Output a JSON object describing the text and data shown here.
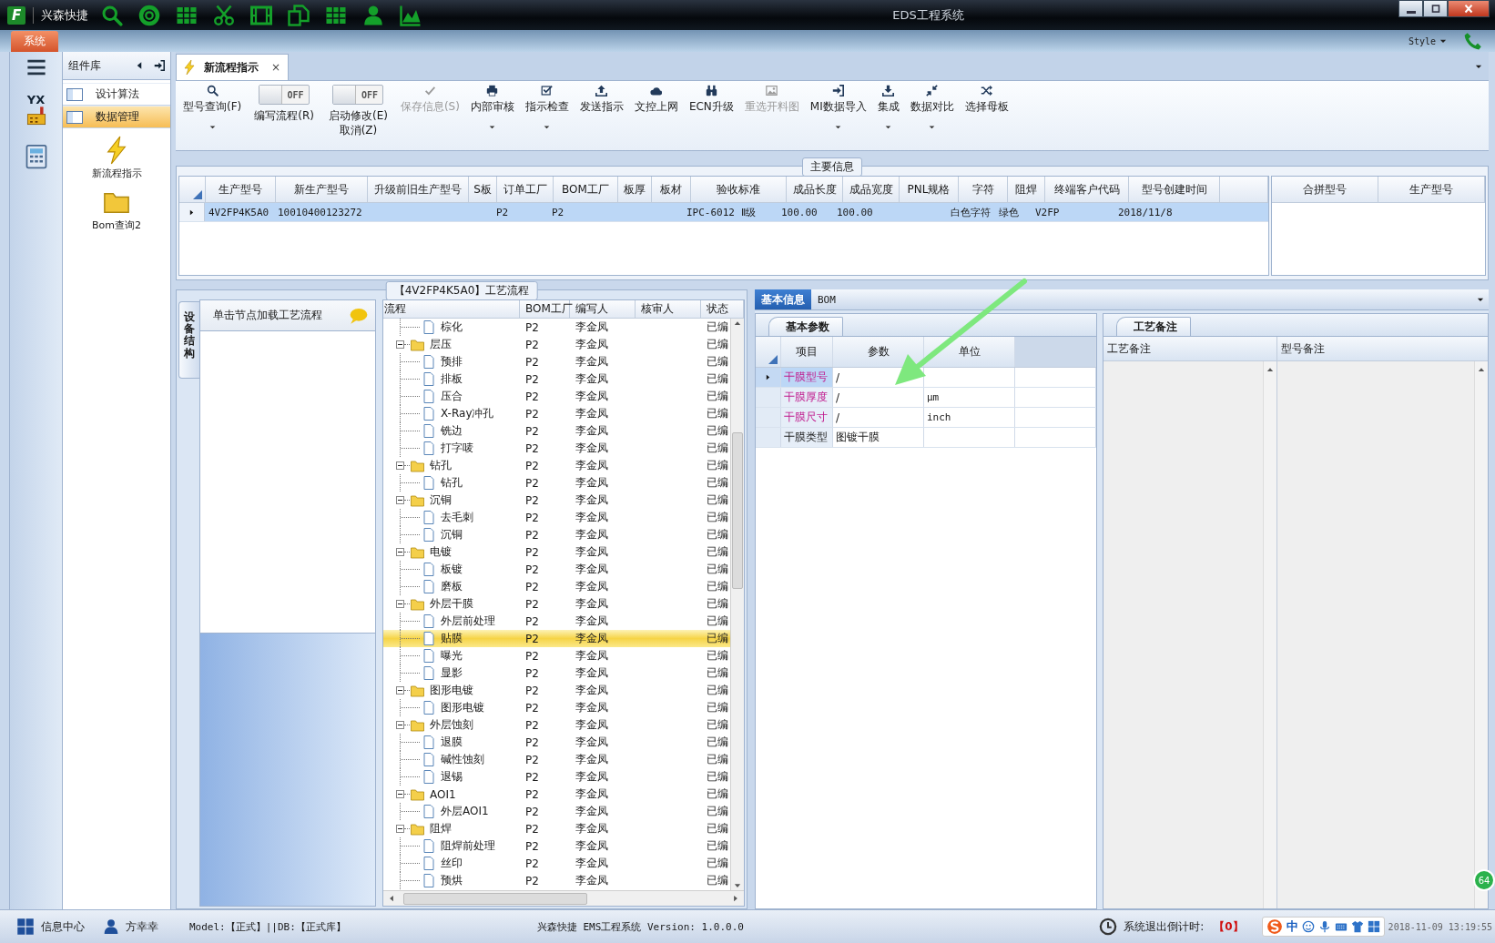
{
  "window": {
    "logo": "F",
    "app_name": "兴森快捷",
    "title": "EDS工程系统"
  },
  "ribbon": {
    "tab": "系统",
    "style_label": "Style"
  },
  "sidebar": {
    "logo_text": "YX"
  },
  "component_panel": {
    "title": "组件库",
    "items": [
      {
        "label": "设计算法",
        "selected": false
      },
      {
        "label": "数据管理",
        "selected": true
      }
    ],
    "shortcuts": [
      "新流程指示",
      "Bom查询2"
    ]
  },
  "doc_tabs": [
    {
      "label": "新流程指示",
      "selected": true,
      "close": "×"
    }
  ],
  "toolbar": [
    {
      "kind": "button",
      "lines": [
        "型号查询(F)"
      ],
      "dropdown": true,
      "disabled": false
    },
    {
      "kind": "toggle",
      "switch": "OFF",
      "on": false,
      "lines": [
        "编写流程(R)"
      ]
    },
    {
      "kind": "toggle",
      "switch": "OFF",
      "on": false,
      "lines": [
        "启动修改(E)",
        "取消(Z)"
      ]
    },
    {
      "kind": "button",
      "lines": [
        "保存信息(S)"
      ],
      "dropdown": false,
      "disabled": true
    },
    {
      "kind": "button",
      "lines": [
        "内部审核"
      ],
      "dropdown": true,
      "disabled": false
    },
    {
      "kind": "button",
      "lines": [
        "指示检查"
      ],
      "dropdown": true,
      "disabled": false
    },
    {
      "kind": "button",
      "lines": [
        "发送指示"
      ],
      "dropdown": false,
      "disabled": false
    },
    {
      "kind": "button",
      "lines": [
        "文控上网"
      ],
      "dropdown": false,
      "disabled": false
    },
    {
      "kind": "button",
      "lines": [
        "ECN升级"
      ],
      "dropdown": false,
      "disabled": false
    },
    {
      "kind": "button",
      "lines": [
        "重选开料图"
      ],
      "dropdown": false,
      "disabled": true
    },
    {
      "kind": "button",
      "lines": [
        "MI数据导入"
      ],
      "dropdown": true,
      "disabled": false
    },
    {
      "kind": "button",
      "lines": [
        "集成"
      ],
      "dropdown": true,
      "disabled": false
    },
    {
      "kind": "button",
      "lines": [
        "数据对比"
      ],
      "dropdown": true,
      "disabled": false
    },
    {
      "kind": "button",
      "lines": [
        "选择母板"
      ],
      "dropdown": false,
      "disabled": false
    }
  ],
  "main_info": {
    "title": "主要信息",
    "columns": [
      "生产型号",
      "新生产型号",
      "升级前旧生产型号",
      "S板",
      "订单工厂",
      "BOM工厂",
      "板厚",
      "板材",
      "验收标准",
      "成品长度",
      "成品宽度",
      "PNL规格",
      "字符",
      "阻焊",
      "终端客户代码",
      "型号创建时间"
    ],
    "rows": [
      {
        "selected": true,
        "cells": [
          "4V2FP4K5A0",
          "10010400123272",
          null,
          null,
          "P2",
          "P2",
          null,
          null,
          "IPC-6012 Ⅱ级",
          "100.00",
          "100.00",
          null,
          "白色字符",
          "绿色",
          "V2FP",
          "2018/11/8"
        ]
      }
    ],
    "side_columns": [
      "合拼型号",
      "生产型号"
    ]
  },
  "process": {
    "title": "【4V2FP4K5A0】工艺流程",
    "side_tab": "设备结构",
    "hint": "单击节点加载工艺流程",
    "columns": [
      "流程",
      "BOM工厂",
      "编写人",
      "核审人",
      "状态"
    ],
    "tree": [
      {
        "children": [
          {
            "kind": "file",
            "label": "棕化",
            "bom": "P2",
            "writer": "李金凤",
            "status": "已编",
            "selected": false
          }
        ]
      },
      {
        "kind": "folder",
        "label": "层压",
        "bom": "P2",
        "writer": "李金凤",
        "status": "已编",
        "selected": false,
        "expanded": true,
        "children": [
          {
            "kind": "file",
            "label": "预排",
            "bom": "P2",
            "writer": "李金凤",
            "status": "已编",
            "selected": false
          },
          {
            "kind": "file",
            "label": "排板",
            "bom": "P2",
            "writer": "李金凤",
            "status": "已编",
            "selected": false
          },
          {
            "kind": "file",
            "label": "压合",
            "bom": "P2",
            "writer": "李金凤",
            "status": "已编",
            "selected": false
          },
          {
            "kind": "file",
            "label": "X-Ray冲孔",
            "bom": "P2",
            "writer": "李金凤",
            "status": "已编",
            "selected": false
          },
          {
            "kind": "file",
            "label": "铣边",
            "bom": "P2",
            "writer": "李金凤",
            "status": "已编",
            "selected": false
          },
          {
            "kind": "file",
            "label": "打字唛",
            "bom": "P2",
            "writer": "李金凤",
            "status": "已编",
            "selected": false
          }
        ]
      },
      {
        "kind": "folder",
        "label": "钻孔",
        "bom": "P2",
        "writer": "李金凤",
        "status": "已编",
        "selected": false,
        "expanded": true,
        "children": [
          {
            "kind": "file",
            "label": "钻孔",
            "bom": "P2",
            "writer": "李金凤",
            "status": "已编",
            "selected": false
          }
        ]
      },
      {
        "kind": "folder",
        "label": "沉铜",
        "bom": "P2",
        "writer": "李金凤",
        "status": "已编",
        "selected": false,
        "expanded": true,
        "children": [
          {
            "kind": "file",
            "label": "去毛刺",
            "bom": "P2",
            "writer": "李金凤",
            "status": "已编",
            "selected": false
          },
          {
            "kind": "file",
            "label": "沉铜",
            "bom": "P2",
            "writer": "李金凤",
            "status": "已编",
            "selected": false
          }
        ]
      },
      {
        "kind": "folder",
        "label": "电镀",
        "bom": "P2",
        "writer": "李金凤",
        "status": "已编",
        "selected": false,
        "expanded": true,
        "children": [
          {
            "kind": "file",
            "label": "板镀",
            "bom": "P2",
            "writer": "李金凤",
            "status": "已编",
            "selected": false
          },
          {
            "kind": "file",
            "label": "磨板",
            "bom": "P2",
            "writer": "李金凤",
            "status": "已编",
            "selected": false
          }
        ]
      },
      {
        "kind": "folder",
        "label": "外层干膜",
        "bom": "P2",
        "writer": "李金凤",
        "status": "已编",
        "selected": false,
        "expanded": true,
        "children": [
          {
            "kind": "file",
            "label": "外层前处理",
            "bom": "P2",
            "writer": "李金凤",
            "status": "已编",
            "selected": false
          },
          {
            "kind": "file",
            "label": "贴膜",
            "bom": "P2",
            "writer": "李金凤",
            "status": "已编",
            "selected": true
          },
          {
            "kind": "file",
            "label": "曝光",
            "bom": "P2",
            "writer": "李金凤",
            "status": "已编",
            "selected": false
          },
          {
            "kind": "file",
            "label": "显影",
            "bom": "P2",
            "writer": "李金凤",
            "status": "已编",
            "selected": false
          }
        ]
      },
      {
        "kind": "folder",
        "label": "图形电镀",
        "bom": "P2",
        "writer": "李金凤",
        "status": "已编",
        "selected": false,
        "expanded": true,
        "children": [
          {
            "kind": "file",
            "label": "图形电镀",
            "bom": "P2",
            "writer": "李金凤",
            "status": "已编",
            "selected": false
          }
        ]
      },
      {
        "kind": "folder",
        "label": "外层蚀刻",
        "bom": "P2",
        "writer": "李金凤",
        "status": "已编",
        "selected": false,
        "expanded": true,
        "children": [
          {
            "kind": "file",
            "label": "退膜",
            "bom": "P2",
            "writer": "李金凤",
            "status": "已编",
            "selected": false
          },
          {
            "kind": "file",
            "label": "碱性蚀刻",
            "bom": "P2",
            "writer": "李金凤",
            "status": "已编",
            "selected": false
          },
          {
            "kind": "file",
            "label": "退锡",
            "bom": "P2",
            "writer": "李金凤",
            "status": "已编",
            "selected": false
          }
        ]
      },
      {
        "kind": "folder",
        "label": "AOI1",
        "bom": "P2",
        "writer": "李金凤",
        "status": "已编",
        "selected": false,
        "expanded": true,
        "children": [
          {
            "kind": "file",
            "label": "外层AOI1",
            "bom": "P2",
            "writer": "李金凤",
            "status": "已编",
            "selected": false
          }
        ]
      },
      {
        "kind": "folder",
        "label": "阻焊",
        "bom": "P2",
        "writer": "李金凤",
        "status": "已编",
        "selected": false,
        "expanded": true,
        "children": [
          {
            "kind": "file",
            "label": "阻焊前处理",
            "bom": "P2",
            "writer": "李金凤",
            "status": "已编",
            "selected": false
          },
          {
            "kind": "file",
            "label": "丝印",
            "bom": "P2",
            "writer": "李金凤",
            "status": "已编",
            "selected": false
          },
          {
            "kind": "file",
            "label": "预烘",
            "bom": "P2",
            "writer": "李金凤",
            "status": "已编",
            "selected": false
          }
        ]
      }
    ]
  },
  "detail": {
    "tabs": [
      {
        "label": "基本信息",
        "selected": true
      },
      {
        "label": "BOM",
        "selected": false
      }
    ],
    "params": {
      "tab": "基本参数",
      "columns": [
        "项目",
        "参数",
        "单位"
      ],
      "rows": [
        {
          "item": "干膜型号",
          "value": "/",
          "required": true,
          "selected": true
        },
        {
          "item": "干膜厚度",
          "value": "/",
          "unit": "μm",
          "required": true,
          "selected": false
        },
        {
          "item": "干膜尺寸",
          "value": "/",
          "unit": "inch",
          "required": true,
          "selected": false
        },
        {
          "item": "干膜类型",
          "value": "图镀干膜",
          "required": false,
          "selected": false
        }
      ]
    },
    "notes": {
      "tab": "工艺备注",
      "columns": [
        "工艺备注",
        "型号备注"
      ]
    }
  },
  "badge": "64",
  "status_bar": {
    "info_center": "信息中心",
    "user": "方幸幸",
    "model_db": "Model:【正式】||DB:【正式库】",
    "version": "兴森快捷 EMS工程系统 Version: 1.0.0.0",
    "countdown_label": "系统退出倒计时:",
    "countdown_value": "【0】",
    "ime": "中",
    "clock": "2018-11-09 13:19:55"
  }
}
